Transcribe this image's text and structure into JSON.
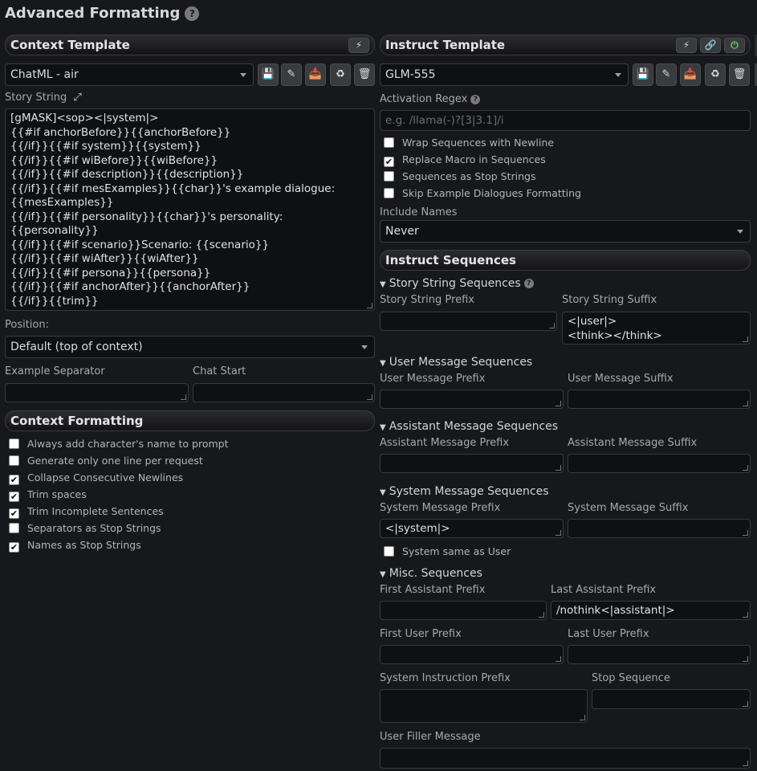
{
  "page": {
    "title": "Advanced Formatting"
  },
  "context": {
    "header": "Context Template",
    "preset": "ChatML - air",
    "story_string_label": "Story String",
    "story_string": "[gMASK]<sop><|system|>\n{{#if anchorBefore}}{{anchorBefore}}\n{{/if}}{{#if system}}{{system}}\n{{/if}}{{#if wiBefore}}{{wiBefore}}\n{{/if}}{{#if description}}{{description}}\n{{/if}}{{#if mesExamples}}{{char}}'s example dialogue:\n{{mesExamples}}\n{{/if}}{{#if personality}}{{char}}'s personality: {{personality}}\n{{/if}}{{#if scenario}}Scenario: {{scenario}}\n{{/if}}{{#if wiAfter}}{{wiAfter}}\n{{/if}}{{#if persona}}{{persona}}\n{{/if}}{{#if anchorAfter}}{{anchorAfter}}\n{{/if}}{{trim}}",
    "position_label": "Position:",
    "position_value": "Default (top of context)",
    "example_separator_label": "Example Separator",
    "chat_start_label": "Chat Start",
    "formatting_header": "Context Formatting",
    "checkboxes": [
      {
        "label": "Always add character's name to prompt",
        "checked": false
      },
      {
        "label": "Generate only one line per request",
        "checked": false
      },
      {
        "label": "Collapse Consecutive Newlines",
        "checked": true
      },
      {
        "label": "Trim spaces",
        "checked": true
      },
      {
        "label": "Trim Incomplete Sentences",
        "checked": true
      },
      {
        "label": "Separators as Stop Strings",
        "checked": false
      },
      {
        "label": "Names as Stop Strings",
        "checked": true
      }
    ]
  },
  "instruct": {
    "header": "Instruct Template",
    "preset": "GLM-555",
    "activation_regex_label": "Activation Regex",
    "activation_regex_placeholder": "e.g. /llama(-)?[3|3.1]/i",
    "checkboxes": [
      {
        "label": "Wrap Sequences with Newline",
        "checked": false
      },
      {
        "label": "Replace Macro in Sequences",
        "checked": true
      },
      {
        "label": "Sequences as Stop Strings",
        "checked": false
      },
      {
        "label": "Skip Example Dialogues Formatting",
        "checked": false
      }
    ],
    "include_names_label": "Include Names",
    "include_names_value": "Never",
    "sequences_header": "Instruct Sequences",
    "story_string_seq": "Story String Sequences",
    "story_prefix_label": "Story String Prefix",
    "story_suffix_label": "Story String Suffix",
    "story_suffix_value": "<|user|>\n<think></think>",
    "user_seq": "User Message Sequences",
    "user_prefix_label": "User Message Prefix",
    "user_suffix_label": "User Message Suffix",
    "assistant_seq": "Assistant Message Sequences",
    "assistant_prefix_label": "Assistant Message Prefix",
    "assistant_suffix_label": "Assistant Message Suffix",
    "system_seq": "System Message Sequences",
    "system_prefix_label": "System Message Prefix",
    "system_prefix_value": "<|system|>",
    "system_suffix_label": "System Message Suffix",
    "system_same_label": "System same as User",
    "misc_seq": "Misc. Sequences",
    "first_assistant_label": "First Assistant Prefix",
    "last_assistant_label": "Last Assistant Prefix",
    "last_assistant_value": "/nothink<|assistant|>",
    "first_user_label": "First User Prefix",
    "last_user_label": "Last User Prefix",
    "system_instruction_label": "System Instruction Prefix",
    "stop_sequence_label": "Stop Sequence",
    "user_filler_label": "User Filler Message"
  },
  "icons": {
    "help": "?",
    "bolt": "⚡",
    "link": "🔗",
    "power": "⏻",
    "save": "💾",
    "edit": "✎",
    "import": "📥",
    "restore": "♻",
    "delete": "🗑",
    "expand": "⤢"
  }
}
